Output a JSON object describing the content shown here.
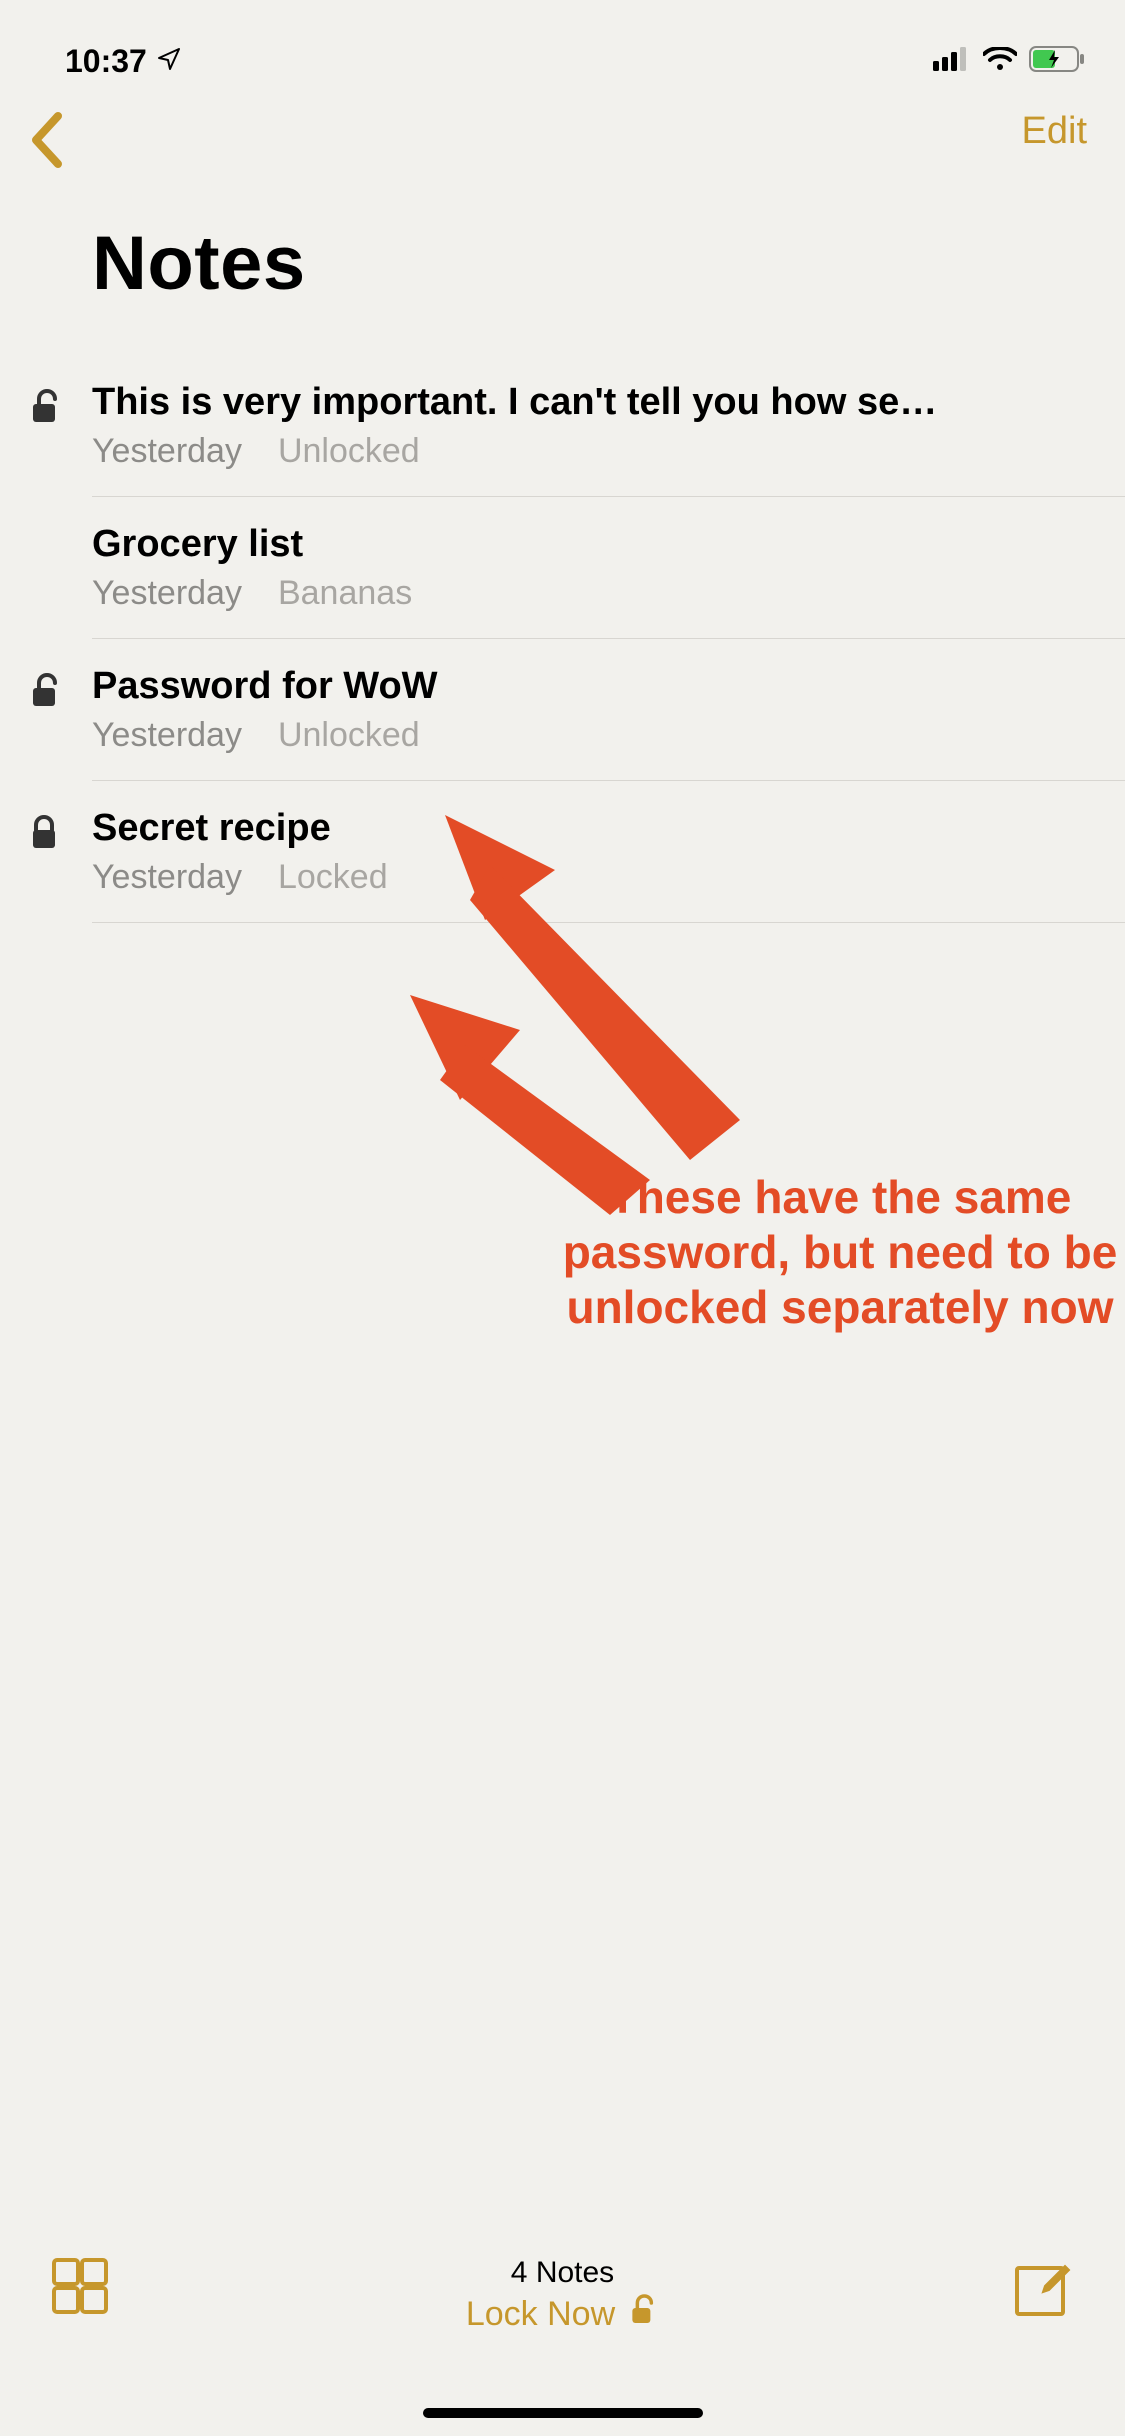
{
  "statusBar": {
    "time": "10:37"
  },
  "nav": {
    "edit": "Edit"
  },
  "pageTitle": "Notes",
  "notes": [
    {
      "title": "This is very important. I can't tell you how se…",
      "date": "Yesterday",
      "preview": "Unlocked",
      "lock": "unlocked"
    },
    {
      "title": "Grocery list",
      "date": "Yesterday",
      "preview": "Bananas",
      "lock": "none"
    },
    {
      "title": "Password for WoW",
      "date": "Yesterday",
      "preview": "Unlocked",
      "lock": "unlocked"
    },
    {
      "title": "Secret recipe",
      "date": "Yesterday",
      "preview": "Locked",
      "lock": "locked"
    }
  ],
  "annotation": {
    "text": "These have the same password, but need to be unlocked separately now"
  },
  "toolbar": {
    "count": "4 Notes",
    "lockNow": "Lock Now"
  }
}
